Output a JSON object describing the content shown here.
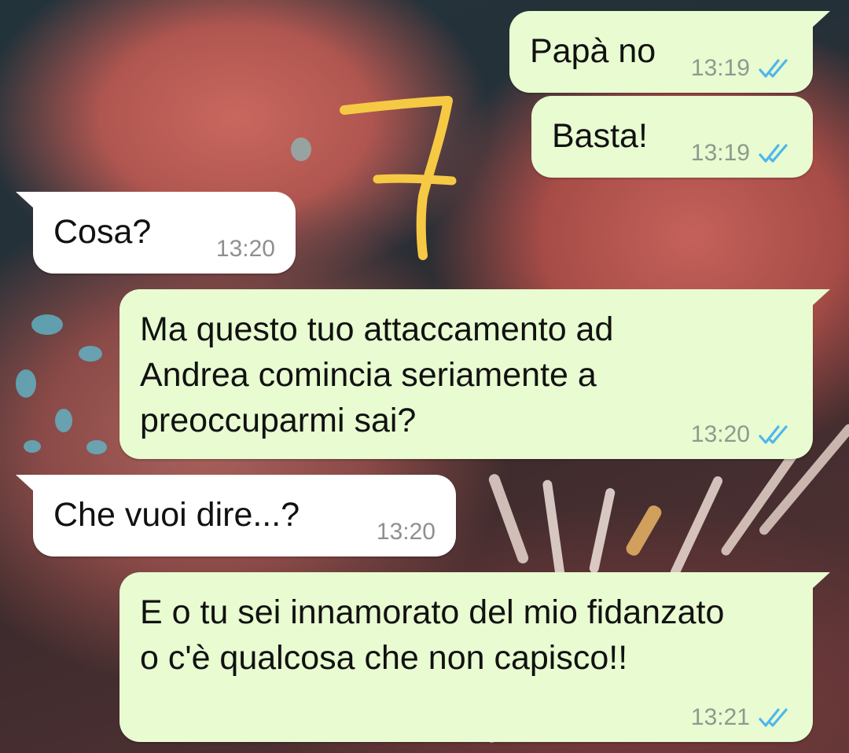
{
  "colors": {
    "outgoing_bubble": "#e8fbd1",
    "incoming_bubble": "#ffffff",
    "read_ticks": "#4fb6ec",
    "annotation": "#f6c944"
  },
  "annotation": {
    "text": "7",
    "style": "handwritten-yellow"
  },
  "messages": [
    {
      "id": "m1",
      "direction": "outgoing",
      "text": "Papà no",
      "time": "13:19",
      "status": "read",
      "status_icon": "double-check-icon"
    },
    {
      "id": "m2",
      "direction": "outgoing",
      "text": "Basta!",
      "time": "13:19",
      "status": "read",
      "status_icon": "double-check-icon"
    },
    {
      "id": "m3",
      "direction": "incoming",
      "text": "Cosa?",
      "time": "13:20"
    },
    {
      "id": "m4",
      "direction": "outgoing",
      "text": "Ma questo tuo attaccamento ad\nAndrea comincia seriamente a\npreoccuparmi sai?",
      "time": "13:20",
      "status": "read",
      "status_icon": "double-check-icon"
    },
    {
      "id": "m5",
      "direction": "incoming",
      "text": "Che vuoi dire...?",
      "time": "13:20"
    },
    {
      "id": "m6",
      "direction": "outgoing",
      "text": "E o tu sei innamorato del mio fidanzato\no c'è qualcosa che non capisco!!",
      "time": "13:21",
      "status": "read",
      "status_icon": "double-check-icon"
    }
  ]
}
